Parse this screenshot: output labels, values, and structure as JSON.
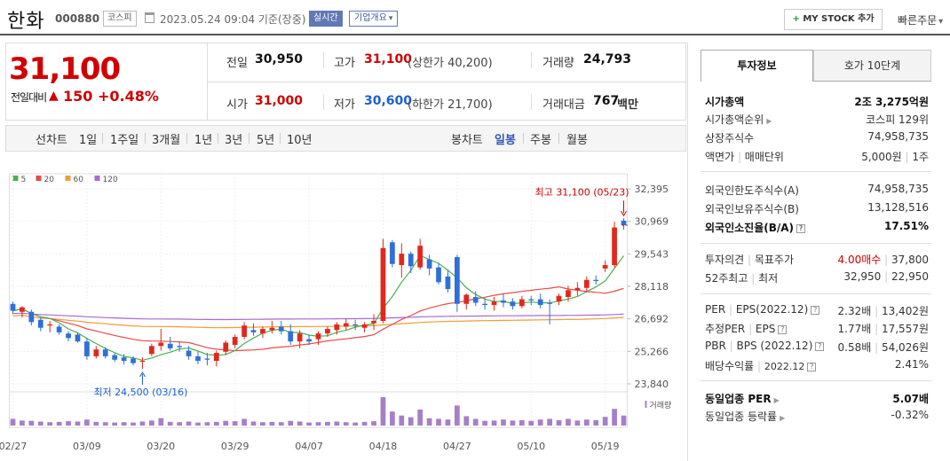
{
  "header": {
    "title": "한화",
    "code": "000880",
    "market": "코스피",
    "date": "2023.05.24 09:04 기준(장중)",
    "realtime": "실시간",
    "company_info": "기업개요",
    "mystock_plus": "+",
    "mystock_label": "MY STOCK 추가",
    "quick_order": "빠른주문"
  },
  "summary": {
    "price": "31,100",
    "change_label": "전일대비",
    "change_arrow": "▲",
    "change_value": "150",
    "change_pct": "+0.48%",
    "prev_label": "전일",
    "prev_value": "30,950",
    "high_label": "고가",
    "high_value": "31,100",
    "high_limit": "(상한가 40,200)",
    "volume_label": "거래량",
    "volume_value": "24,793",
    "open_label": "시가",
    "open_value": "31,000",
    "low_label": "저가",
    "low_value": "30,600",
    "low_limit": "(하한가 21,700)",
    "amount_label": "거래대금",
    "amount_value": "767",
    "amount_unit": "백만"
  },
  "periods": {
    "line_label": "선차트",
    "line_items": [
      "1일",
      "1주일",
      "3개월",
      "1년",
      "3년",
      "5년",
      "10년"
    ],
    "candle_label": "봉차트",
    "candle_items": [
      "일봉",
      "주봉",
      "월봉"
    ],
    "active_candle": "일봉"
  },
  "chart_data": {
    "type": "candlestick",
    "legend": [
      {
        "name": "5",
        "color": "#4caf50"
      },
      {
        "name": "20",
        "color": "#e84a4a"
      },
      {
        "name": "60",
        "color": "#f39c33"
      },
      {
        "name": "120",
        "color": "#a66bd6"
      }
    ],
    "y_ticks": [
      32395,
      30969,
      29543,
      28118,
      26692,
      25266,
      23840
    ],
    "y_tick_labels": [
      "32,395",
      "30,969",
      "29,543",
      "28,118",
      "26,692",
      "25,266",
      "23,840"
    ],
    "ylim": [
      23840,
      32395
    ],
    "x_tick_labels": [
      "02/27",
      "03/09",
      "03/20",
      "03/29",
      "04/07",
      "04/18",
      "04/27",
      "05/10",
      "05/19"
    ],
    "x_tick_index": [
      0,
      8,
      16,
      24,
      32,
      40,
      48,
      56,
      64
    ],
    "max_label": "최고 31,100 (05/23)",
    "min_label": "최저 24,500 (03/16)",
    "max_index": 66,
    "min_index": 14,
    "volume_label": "거래량",
    "candles": [
      [
        27350,
        27450,
        26900,
        27050
      ],
      [
        27000,
        27250,
        26750,
        27200
      ],
      [
        27000,
        27100,
        26400,
        26550
      ],
      [
        26650,
        26750,
        26150,
        26300
      ],
      [
        26400,
        26600,
        26100,
        26450
      ],
      [
        26350,
        26450,
        26000,
        26100
      ],
      [
        26050,
        26150,
        25700,
        25850
      ],
      [
        26000,
        26100,
        25650,
        25700
      ],
      [
        25700,
        25850,
        24900,
        25050
      ],
      [
        25050,
        25500,
        24950,
        25350
      ],
      [
        25350,
        25450,
        24950,
        25050
      ],
      [
        25100,
        25200,
        24800,
        24900
      ],
      [
        25000,
        25150,
        24700,
        24850
      ],
      [
        24950,
        25050,
        24650,
        24750
      ],
      [
        24850,
        25000,
        24500,
        24850
      ],
      [
        25150,
        25600,
        25050,
        25500
      ],
      [
        25500,
        26250,
        25300,
        25650
      ],
      [
        25600,
        25900,
        25300,
        25400
      ],
      [
        25500,
        25700,
        25250,
        25450
      ],
      [
        25300,
        25500,
        24900,
        25050
      ],
      [
        25050,
        25250,
        24700,
        24850
      ],
      [
        24950,
        25200,
        24650,
        24900
      ],
      [
        24850,
        25300,
        24600,
        25200
      ],
      [
        25250,
        25750,
        25100,
        25650
      ],
      [
        25550,
        26000,
        25400,
        25900
      ],
      [
        25900,
        26550,
        25800,
        26400
      ],
      [
        26200,
        26500,
        25950,
        26100
      ],
      [
        26050,
        26350,
        25850,
        26250
      ],
      [
        26200,
        26600,
        26050,
        26300
      ],
      [
        26350,
        26600,
        26000,
        26150
      ],
      [
        26150,
        26450,
        25550,
        25700
      ],
      [
        25700,
        26200,
        25400,
        26050
      ],
      [
        25800,
        26000,
        25550,
        25700
      ],
      [
        25800,
        26150,
        25550,
        26050
      ],
      [
        26050,
        26350,
        25900,
        26250
      ],
      [
        26200,
        26550,
        26000,
        26450
      ],
      [
        26350,
        26700,
        26200,
        26500
      ],
      [
        26450,
        26650,
        26200,
        26400
      ],
      [
        26300,
        26550,
        26100,
        26450
      ],
      [
        26500,
        26900,
        26200,
        26600
      ],
      [
        26600,
        30200,
        26500,
        29800
      ],
      [
        30050,
        30150,
        28950,
        29100
      ],
      [
        29050,
        30000,
        28500,
        29550
      ],
      [
        29550,
        29650,
        28700,
        29000
      ],
      [
        28950,
        30200,
        28850,
        29900
      ],
      [
        29300,
        29500,
        28600,
        28900
      ],
      [
        28950,
        29150,
        28200,
        28300
      ],
      [
        28550,
        28850,
        27850,
        28000
      ],
      [
        29400,
        29500,
        27000,
        27350
      ],
      [
        27350,
        27800,
        27100,
        27750
      ],
      [
        27650,
        27900,
        27250,
        27400
      ],
      [
        27350,
        27600,
        27100,
        27300
      ],
      [
        27300,
        27650,
        27050,
        27450
      ],
      [
        27500,
        27800,
        27200,
        27400
      ],
      [
        27450,
        27600,
        27100,
        27250
      ],
      [
        27250,
        27700,
        27150,
        27550
      ],
      [
        27550,
        27700,
        27300,
        27500
      ],
      [
        27550,
        27800,
        27150,
        27300
      ],
      [
        27400,
        27550,
        26450,
        27350
      ],
      [
        27450,
        27800,
        27300,
        27700
      ],
      [
        27650,
        28150,
        27450,
        27950
      ],
      [
        27950,
        28300,
        27700,
        28050
      ],
      [
        28050,
        28550,
        27850,
        28400
      ],
      [
        28400,
        28600,
        28200,
        28350
      ],
      [
        28900,
        29250,
        28750,
        29050
      ],
      [
        29050,
        30950,
        28950,
        30700
      ],
      [
        31000,
        31100,
        30600,
        30800
      ]
    ],
    "volume": [
      20,
      15,
      14,
      12,
      10,
      11,
      13,
      12,
      18,
      11,
      10,
      9,
      10,
      9,
      12,
      15,
      22,
      11,
      10,
      12,
      9,
      10,
      11,
      14,
      13,
      20,
      12,
      10,
      11,
      10,
      14,
      12,
      9,
      10,
      11,
      12,
      10,
      9,
      11,
      13,
      85,
      42,
      30,
      25,
      48,
      22,
      20,
      18,
      60,
      28,
      20,
      14,
      15,
      18,
      15,
      16,
      14,
      18,
      20,
      16,
      20,
      15,
      18,
      16,
      26,
      50,
      30
    ]
  },
  "right_panel": {
    "tab1": "투자정보",
    "tab2": "호가 10단계",
    "market_cap_label": "시가총액",
    "market_cap_value": "2조 3,275억원",
    "cap_rank_label": "시가총액순위",
    "cap_rank_value": "코스피 129위",
    "shares_label": "상장주식수",
    "shares_value": "74,958,735",
    "par_label": "액면가",
    "lot_label": "매매단위",
    "par_value": "5,000원",
    "lot_value": "1주",
    "foreign_limit_label": "외국인한도주식수(A)",
    "foreign_limit_value": "74,958,735",
    "foreign_hold_label": "외국인보유주식수(B)",
    "foreign_hold_value": "13,128,516",
    "foreign_ratio_label": "외국인소진율(B/A)",
    "foreign_ratio_value": "17.51%",
    "opinion_label": "투자의견",
    "target_label": "목표주가",
    "opinion_value": "4.00매수",
    "target_value": "37,800",
    "w52_label": "52주최고",
    "w52_low_label": "최저",
    "w52_high": "32,950",
    "w52_low": "22,950",
    "per_label": "PER",
    "eps_label": "EPS(2022.12)",
    "per_value": "2.32배",
    "eps_value": "13,402원",
    "est_per_label": "추정PER",
    "est_eps_label": "EPS",
    "est_per_value": "1.77배",
    "est_eps_value": "17,557원",
    "pbr_label": "PBR",
    "bps_label": "BPS (2022.12)",
    "pbr_value": "0.58배",
    "bps_value": "54,026원",
    "div_label": "배당수익률",
    "div_period": "2022.12",
    "div_value": "2.41%",
    "ind_per_label": "동일업종 PER",
    "ind_per_value": "5.07배",
    "ind_rate_label": "동일업종 등락률",
    "ind_rate_value": "-0.32%"
  }
}
